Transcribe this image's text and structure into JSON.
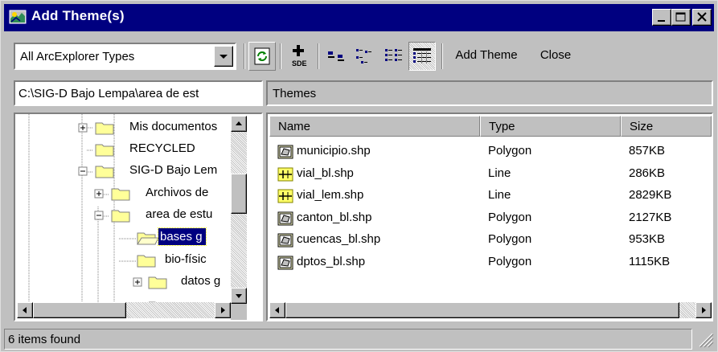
{
  "window": {
    "title": "Add Theme(s)",
    "controls": [
      "minimize-icon",
      "maximize-icon",
      "close-icon"
    ]
  },
  "toolbar": {
    "type_filter": "All ArcExplorer Types",
    "buttons": [
      "refresh-icon",
      "add-sde-layer-icon",
      "large-icons-view-icon",
      "small-icons-view-icon",
      "list-view-icon",
      "details-view-icon"
    ],
    "add_theme_label": "Add Theme",
    "close_label": "Close"
  },
  "path": "C:\\SIG-D Bajo Lempa\\area de est",
  "themes_label": "Themes",
  "tree": {
    "items": [
      {
        "label": "Mis documentos",
        "expander": "+"
      },
      {
        "label": "RECYCLED",
        "expander": ""
      },
      {
        "label": "SIG-D Bajo Lem",
        "expander": "-"
      },
      {
        "label": "Archivos de",
        "expander": "+"
      },
      {
        "label": "area de estu",
        "expander": "-"
      },
      {
        "label": "bases g",
        "expander": "",
        "selected": true
      },
      {
        "label": "bio-físic",
        "expander": ""
      },
      {
        "label": "datos g",
        "expander": "+"
      }
    ]
  },
  "list": {
    "columns": [
      "Name",
      "Type",
      "Size"
    ],
    "rows": [
      {
        "name": "municipio.shp",
        "type": "Polygon",
        "size": "857KB",
        "icon": "polygon-shapefile-icon"
      },
      {
        "name": "vial_bl.shp",
        "type": "Line",
        "size": "286KB",
        "icon": "line-shapefile-icon"
      },
      {
        "name": "vial_lem.shp",
        "type": "Line",
        "size": "2829KB",
        "icon": "line-shapefile-icon"
      },
      {
        "name": "canton_bl.shp",
        "type": "Polygon",
        "size": "2127KB",
        "icon": "polygon-shapefile-icon"
      },
      {
        "name": "cuencas_bl.shp",
        "type": "Polygon",
        "size": "953KB",
        "icon": "polygon-shapefile-icon"
      },
      {
        "name": "dptos_bl.shp",
        "type": "Polygon",
        "size": "1115KB",
        "icon": "polygon-shapefile-icon"
      }
    ]
  },
  "status": "6 items found",
  "colors": {
    "titlebar": "#000080",
    "face": "#c0c0c0",
    "selection": "#000080",
    "folder": "#ffff99"
  }
}
